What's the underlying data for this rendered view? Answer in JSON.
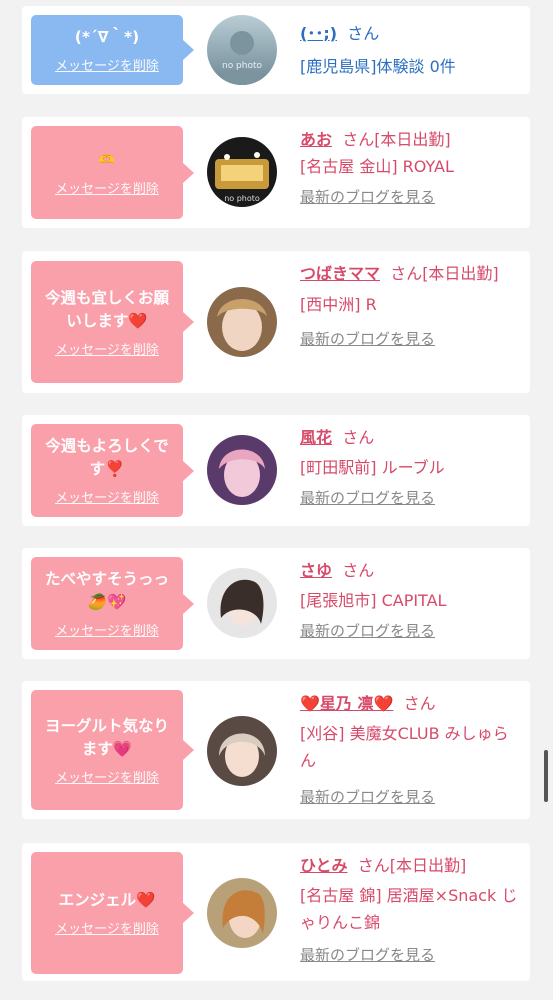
{
  "entries": [
    {
      "bubble_color": "blue",
      "message": "(*´∇｀*)",
      "delete_label": "メッセージを削除",
      "avatar_label": "no photo",
      "name": "(･･;)",
      "honorific": "さん",
      "shop": "[鹿児島県]体験談 0件",
      "blog_label": ""
    },
    {
      "bubble_color": "pink",
      "message": "🫶",
      "delete_label": "メッセージを削除",
      "avatar_label": "no photo",
      "name": "あお",
      "honorific": "さん[本日出勤]",
      "shop": "[名古屋 金山] ROYAL",
      "blog_label": "最新のブログを見る"
    },
    {
      "bubble_color": "pink",
      "message": "今週も宜しくお願いします❤️",
      "delete_label": "メッセージを削除",
      "name": "つばきママ",
      "honorific": "さん[本日出勤]",
      "shop": "[西中洲] R",
      "blog_label": "最新のブログを見る"
    },
    {
      "bubble_color": "pink",
      "message": "今週もよろしくです❣️",
      "delete_label": "メッセージを削除",
      "name": "風花",
      "honorific": "さん",
      "shop": "[町田駅前] ルーブル",
      "blog_label": "最新のブログを見る"
    },
    {
      "bubble_color": "pink",
      "message": "たべやすそうっっ🥭💖",
      "delete_label": "メッセージを削除",
      "name": "さゆ",
      "honorific": "さん",
      "shop": "[尾張旭市] CAPITAL",
      "blog_label": "最新のブログを見る"
    },
    {
      "bubble_color": "pink",
      "message": "ヨーグルト気なります💗",
      "delete_label": "メッセージを削除",
      "name": "❤️星乃 凛❤️",
      "honorific": "さん",
      "shop": "[刈谷] 美魔女CLUB みしゅらん",
      "blog_label": "最新のブログを見る"
    },
    {
      "bubble_color": "pink",
      "message": "エンジェル❤️",
      "delete_label": "メッセージを削除",
      "name": "ひとみ",
      "honorific": "さん[本日出勤]",
      "shop": "[名古屋 錦] 居酒屋×Snack じゃりんこ錦",
      "blog_label": "最新のブログを見る"
    }
  ]
}
